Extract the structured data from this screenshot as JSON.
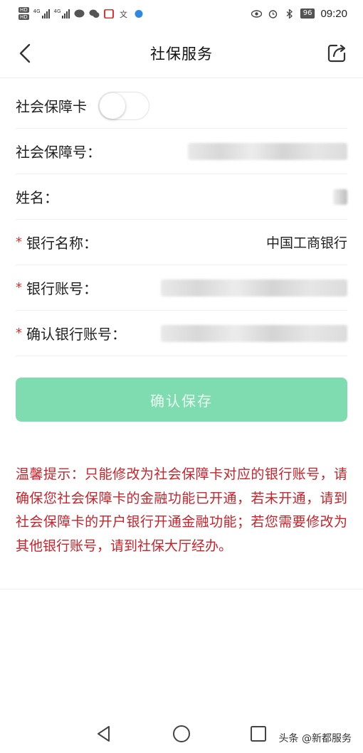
{
  "status_bar": {
    "hd_badges": [
      "HD",
      "HD"
    ],
    "network_labels": [
      "4G",
      "4G"
    ],
    "battery": "96",
    "time": "09:20"
  },
  "header": {
    "title": "社保服务",
    "back_icon": "chevron-left-icon",
    "share_icon": "share-icon"
  },
  "form": {
    "social_card_label": "社会保障卡",
    "social_card_toggle_on": false,
    "social_number_label": "社会保障号：",
    "name_label": "姓名：",
    "required_mark": "*",
    "bank_name_label": "银行名称：",
    "bank_name_value": "中国工商银行",
    "bank_account_label": "银行账号：",
    "confirm_account_label": "确认银行账号："
  },
  "save_button": {
    "label": "确认保存",
    "color": "#7fdcb0"
  },
  "notice": {
    "text": "温馨提示：只能修改为社会保障卡对应的银行账号，请确保您社会保障卡的金融功能已开通，若未开通，请到社会保障卡的开户银行开通金融功能；若您需要修改为其他银行账号，请到社保大厅经办。",
    "color": "#c8232b"
  },
  "nav_bar": {
    "icons": [
      "back-triangle-icon",
      "home-circle-icon",
      "recents-square-icon"
    ]
  },
  "watermark": "头条 @新都服务"
}
